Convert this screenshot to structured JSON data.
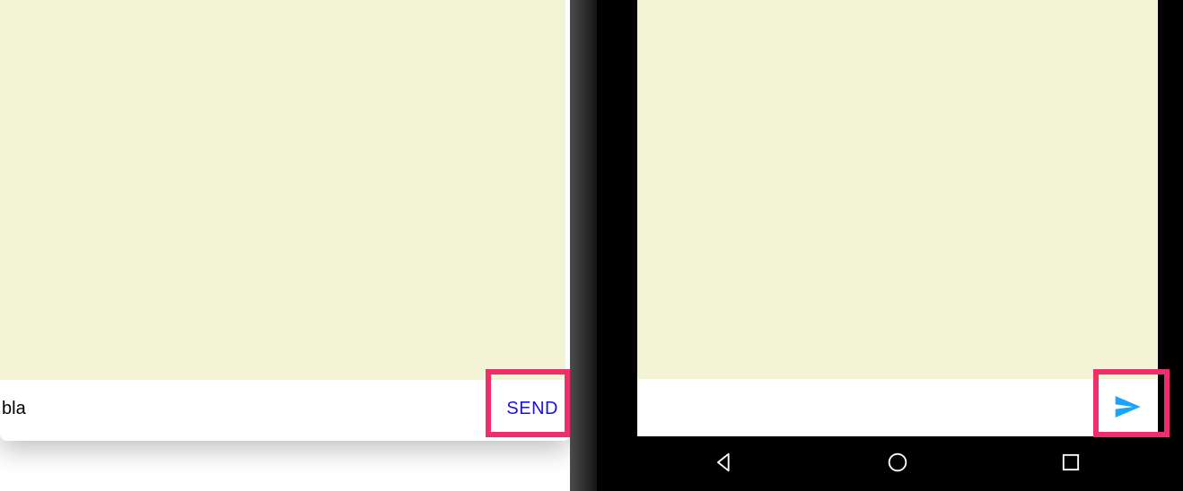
{
  "left": {
    "input_value": "bla",
    "send_label": "SEND"
  },
  "right": {
    "input_value": "",
    "send_icon": "send-icon"
  },
  "colors": {
    "highlight": "#ef2e6b",
    "chat_bg": "#f3f3d5",
    "send_text": "#1a12d6",
    "send_arrow": "#1aa3ff"
  },
  "android_nav": {
    "back": "back-icon",
    "home": "home-icon",
    "recent": "recent-icon"
  }
}
